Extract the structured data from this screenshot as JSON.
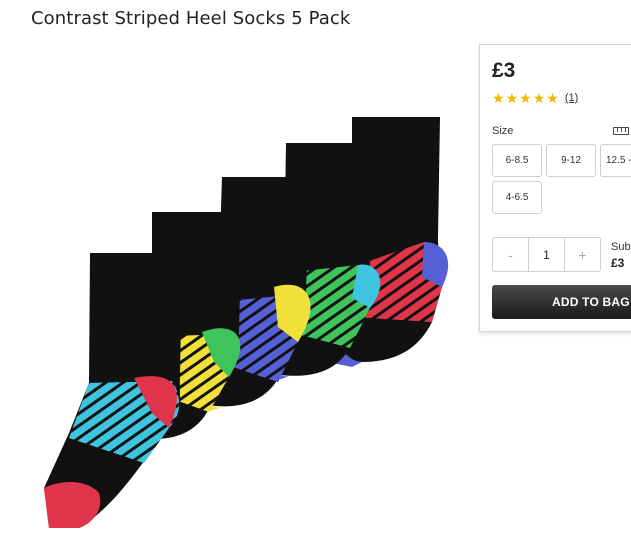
{
  "product": {
    "title": "Contrast Striped Heel Socks 5 Pack",
    "image_icon": "socks-product-image"
  },
  "purchase": {
    "price": "£3",
    "rating": {
      "stars": 5,
      "max": 5,
      "review_count": "(1)"
    },
    "size_label": "Size",
    "size_guide_icon": "ruler-icon",
    "sizes": [
      "6-8.5",
      "9-12",
      "12.5 -",
      "4-6.5"
    ],
    "quantity": {
      "minus": "-",
      "value": "1",
      "plus": "+"
    },
    "subtotal_label": "Subt",
    "subtotal_value": "£3",
    "add_to_bag": "ADD TO BAG"
  },
  "colors": {
    "star": "#f3b700",
    "button": "#222222",
    "sock_body": "#111111"
  }
}
